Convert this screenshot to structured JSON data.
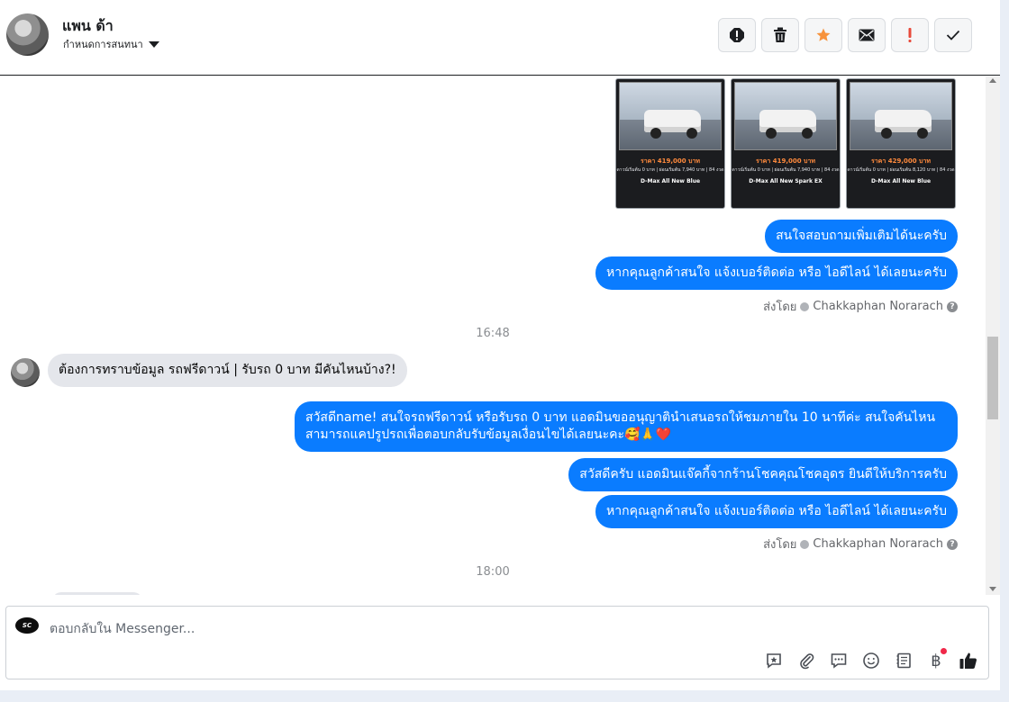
{
  "header": {
    "name": "แพน ด้า",
    "assign_label": "กำหนดการสนทนา"
  },
  "toolbar": {
    "buttons": [
      "report-spam",
      "delete",
      "star",
      "mark-unread",
      "important",
      "done"
    ]
  },
  "thread": {
    "cards": [
      {
        "price": "ราคา 419,000 บาท",
        "line1": "ดาวน์เริ่มต้น 0 บาท | ผ่อนเริ่มต้น 7,940 บาท | 84 งวด",
        "model": "D-Max All New Blue"
      },
      {
        "price": "ราคา 419,000 บาท",
        "line1": "ดาวน์เริ่มต้น 0 บาท | ผ่อนเริ่มต้น 7,940 บาท | 84 งวด",
        "model": "D-Max All New Spark EX"
      },
      {
        "price": "ราคา 429,000 บาท",
        "line1": "ดาวน์เริ่มต้น 0 บาท | ผ่อนเริ่มต้น 8,120 บาท | 84 งวด",
        "model": "D-Max All New Blue"
      }
    ],
    "out_msg_1": "สนใจสอบถามเพิ่มเติมได้นะครับ",
    "out_msg_2": "หากคุณลูกค้าสนใจ แจ้งเบอร์ติดต่อ หรือ ไอดีไลน์ ได้เลยนะครับ",
    "sent_by_label": "ส่งโดย",
    "sent_by_name": "Chakkaphan Norarach",
    "time_1": "16:48",
    "in_msg_1": "ต้องการทราบข้อมูล รถฟรีดาวน์ | รับรถ 0 บาท มีคันไหนบ้าง?!",
    "out_msg_3": "สวัสดีname! สนใจรถฟรีดาวน์ หรือรับรถ 0 บาท แอดมินขออนุญาตินำเสนอรถให้ชมภายใน 10 นาทีค่ะ สนใจคันไหนสามารถแคปรูปรถเพื่อตอบกลับรับข้อมูลเงื่อนไขได้เลยนะคะ🥰🙏❤️",
    "out_msg_4": "สวัสดีครับ แอดมินแจ๊คกี้จากร้านโชคคุณโชคอุดร ยินดีให้บริการครับ",
    "out_msg_5": "หากคุณลูกค้าสนใจ แจ้งเบอร์ติดต่อ หรือ ไอดีไลน์ ได้เลยนะครับ",
    "time_2": "18:00"
  },
  "composer": {
    "placeholder": "ตอบกลับใน Messenger...",
    "icons": [
      "saved-reply-icon",
      "attachment-icon",
      "message-template-icon",
      "emoji-icon",
      "notes-icon",
      "baht-payment-icon",
      "like-icon"
    ]
  },
  "colors": {
    "outgoing_bubble": "#0a7cff",
    "incoming_bubble": "#e4e6eb",
    "star": "#f7923b",
    "important": "#e84a3b"
  }
}
